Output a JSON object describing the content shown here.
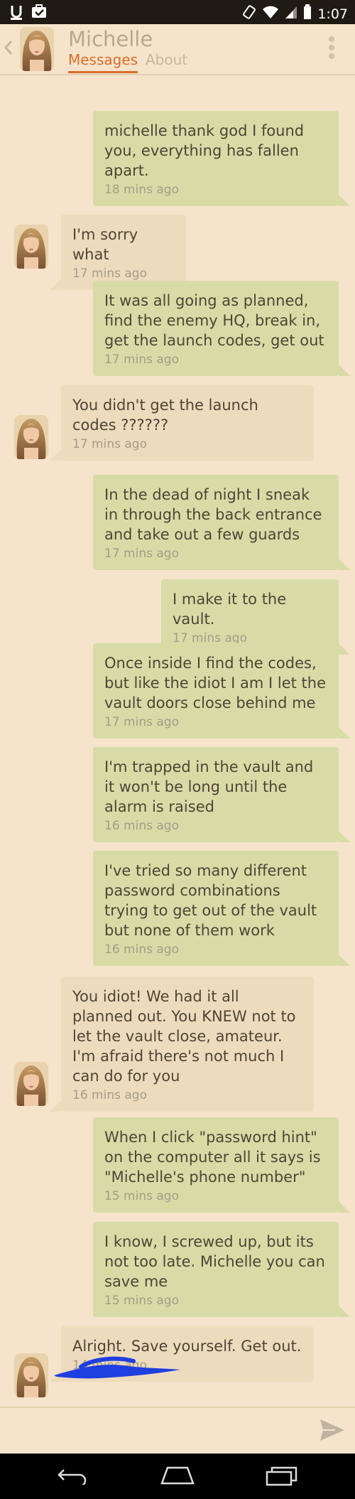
{
  "status_bar": {
    "time": "1:07"
  },
  "header": {
    "contact_name": "Michelle",
    "tabs": [
      "Messages",
      "About"
    ]
  },
  "messages": [
    {
      "dir": "out",
      "text": "michelle thank god I found you, everything has fallen apart.",
      "time": "18 mins ago"
    },
    {
      "dir": "in",
      "text": "I'm sorry what",
      "time": "17 mins ago"
    },
    {
      "dir": "out",
      "text": "It was all going as planned, find the enemy HQ, break in, get the launch codes, get out",
      "time": "17 mins ago"
    },
    {
      "dir": "in",
      "text": "You didn't get the launch codes ??????",
      "time": "17 mins ago"
    },
    {
      "dir": "out",
      "text": "In the dead of night I sneak in through the back entrance and take out a few guards",
      "time": "17 mins ago"
    },
    {
      "dir": "out",
      "text": "I make it to the vault.",
      "time": "17 mins ago"
    },
    {
      "dir": "out",
      "text": "Once inside I find the codes, but like the idiot I am I let the vault doors close behind me",
      "time": "17 mins ago"
    },
    {
      "dir": "out",
      "text": "I'm trapped in the vault and it won't be long until the alarm is raised",
      "time": "16 mins ago"
    },
    {
      "dir": "out",
      "text": "I've tried so many different password combinations trying to get out of the vault but none of them work",
      "time": "16 mins ago"
    },
    {
      "dir": "in",
      "text": "You idiot! We had it all planned out. You KNEW not to let the vault close, amateur. I'm afraid there's not much I can do for you",
      "time": "16 mins ago"
    },
    {
      "dir": "out",
      "text": "When I click \"password hint\" on the computer all it says is \"Michelle's phone number\"",
      "time": "15 mins ago"
    },
    {
      "dir": "out",
      "text": "I know, I screwed up, but its not too late. Michelle you can save me",
      "time": "15 mins ago"
    },
    {
      "dir": "in",
      "text": "Alright. Save yourself. Get out.",
      "time": "14 mins ago"
    }
  ],
  "icons": {
    "status": [
      "usb-icon",
      "briefcase-icon",
      "rotate-icon",
      "wifi-icon",
      "signal-icon",
      "battery-icon"
    ],
    "nav": [
      "back-nav-icon",
      "home-nav-icon",
      "recents-nav-icon"
    ]
  },
  "colors": {
    "background": "#f5e4cb",
    "outgoing_bubble": "#d8dba6",
    "incoming_bubble": "#eddbbd",
    "accent": "#db6b2a"
  }
}
